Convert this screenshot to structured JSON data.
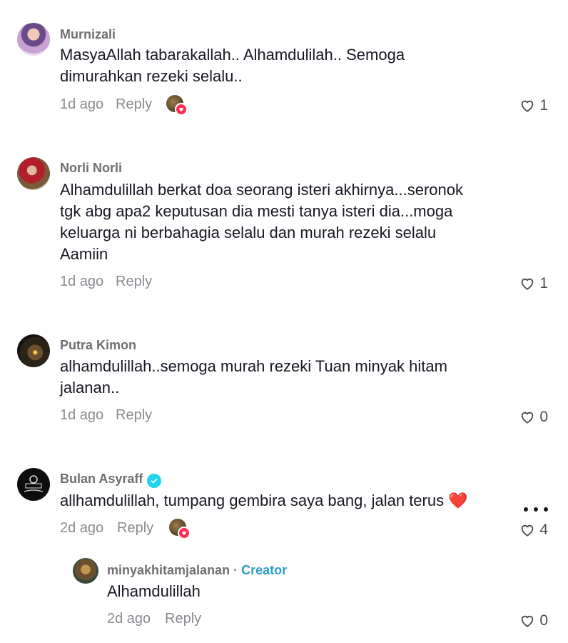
{
  "comments": [
    {
      "username": "Murnizali",
      "text": "MasyaAllah tabarakallah.. Alhamdulilah.. Semoga\ndimurahkan rezeki selalu..",
      "time": "1d ago",
      "reply_label": "Reply",
      "likes": "1",
      "creator_liked": true
    },
    {
      "username": "Norli Norli",
      "text": "Alhamdulillah berkat doa seorang isteri akhirnya...seronok\ntgk abg apa2 keputusan dia mesti tanya isteri dia...moga\nkeluarga ni berbahagia selalu dan murah rezeki selalu\nAamiin",
      "time": "1d ago",
      "reply_label": "Reply",
      "likes": "1",
      "creator_liked": false
    },
    {
      "username": "Putra Kimon",
      "text": "alhamdulillah..semoga murah rezeki Tuan minyak hitam\njalanan..",
      "time": "1d ago",
      "reply_label": "Reply",
      "likes": "0",
      "creator_liked": false
    },
    {
      "username": "Bulan Asyraff",
      "verified": true,
      "text": "allhamdulillah, tumpang gembira saya bang, jalan terus ❤️",
      "time": "2d ago",
      "reply_label": "Reply",
      "likes": "4",
      "creator_liked": true
    }
  ],
  "reply": {
    "username": "minyakhitamjalanan",
    "separator": "·",
    "badge": "Creator",
    "text": "Alhamdulillah",
    "time": "2d ago",
    "reply_label": "Reply",
    "likes": "0"
  },
  "colors": {
    "text": "#161823",
    "muted": "#8a8b91",
    "username": "#6f6f73",
    "creator_badge": "#2f9dc5",
    "heart_badge": "#fe2c55",
    "verified": "#20d5ec"
  },
  "icons": {
    "like": "heart-outline-icon",
    "more": "more-dots-icon",
    "verified": "verified-check-icon",
    "creator_liked": "heart-badge-icon"
  }
}
